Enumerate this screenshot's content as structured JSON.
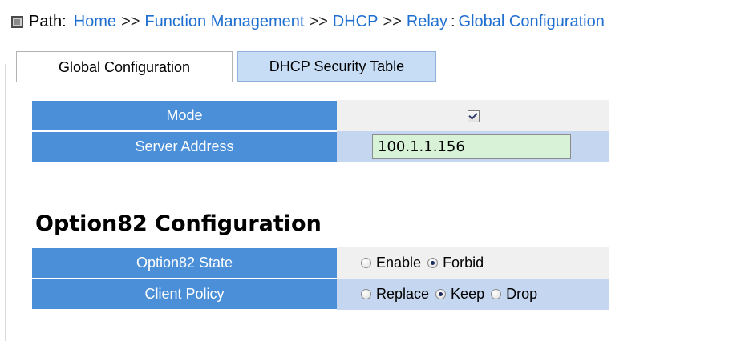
{
  "path": {
    "label": "Path:",
    "crumbs": [
      "Home",
      "Function Management",
      "DHCP",
      "Relay"
    ],
    "separator": ">>",
    "final_separator": ":",
    "current": "Global Configuration"
  },
  "tabs": [
    {
      "label": "Global Configuration",
      "active": true
    },
    {
      "label": "DHCP Security Table",
      "active": false
    }
  ],
  "global": {
    "mode_label": "Mode",
    "mode_checked": true,
    "server_label": "Server Address",
    "server_value": "100.1.1.156"
  },
  "option82": {
    "title": "Option82 Configuration",
    "state_label": "Option82 State",
    "state_options": [
      "Enable",
      "Forbid"
    ],
    "state_selected": "Forbid",
    "policy_label": "Client Policy",
    "policy_options": [
      "Replace",
      "Keep",
      "Drop"
    ],
    "policy_selected": "Keep"
  },
  "colors": {
    "label_bg": "#4a8fd8",
    "link": "#1f6fd1",
    "input_bg": "#d7f2d7",
    "alt_row": "#c5d7f0"
  }
}
